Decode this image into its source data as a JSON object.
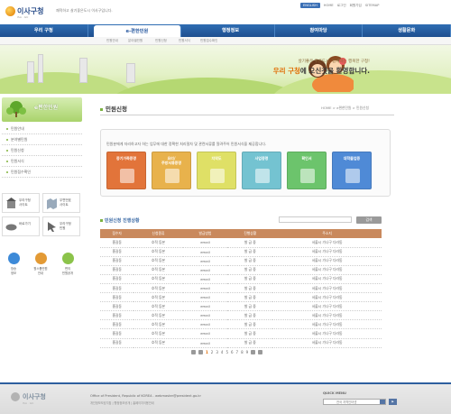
{
  "header": {
    "logo_text": "이사구청",
    "logo_sub": "ISA · GU",
    "slogan": "쾌적하고 살기좋은도시 이사구입니다.",
    "toplinks": [
      "ENGLISH",
      "HOME",
      "로그인",
      "회원가입",
      "SITEMAP"
    ]
  },
  "gnb": {
    "items": [
      "우리 구청",
      "e-편한민원",
      "행정정보",
      "참여마당",
      "생활문화"
    ],
    "active": "e-편한민원"
  },
  "subnav": [
    "민원안내",
    "분야별민원",
    "민원신청",
    "민원서식",
    "민원접수확인"
  ],
  "banner": {
    "line1": "살기좋은 푸른도시, 함께하는 행복한 구청!",
    "line2_a": "우리 구청",
    "line2_b": "에 오신것을 환영합니다."
  },
  "left": {
    "title": "e편한민원",
    "menu": [
      "민원안내",
      "분야별민원",
      "민원신청",
      "민원서식",
      "민원접수확인"
    ],
    "quick": [
      {
        "label": "우리구청\n사이트",
        "icon": "building-icon"
      },
      {
        "label": "우편번호\n사이트",
        "icon": "map-icon"
      },
      {
        "label": "바로가기",
        "icon": "hands-icon"
      },
      {
        "label": "우리구청\n민원",
        "icon": "pointer-icon"
      }
    ],
    "icons": [
      {
        "label": "방송\n정보",
        "color": "#3d8ad8"
      },
      {
        "label": "원스톱민원\n안내",
        "color": "#e39a35"
      },
      {
        "label": "편의\n민원공개",
        "color": "#8bc34a"
      }
    ]
  },
  "content": {
    "title": "민원신청",
    "path": "HOME > e편한민원 > 민원신청",
    "desc": "민원분에게 자리하고자 하는 업무에 대한 정확한 처리절차 및 관련서류를 알려주어 민원서식을 제공합니다.",
    "services": [
      {
        "label": "증기가족증명",
        "color": "#e2743a"
      },
      {
        "label": "요리/\n주방서류증명",
        "color": "#e8b24c"
      },
      {
        "label": "지역도",
        "color": "#dfe066"
      },
      {
        "label": "사업증명",
        "color": "#74c3d1"
      },
      {
        "label": "확인서",
        "color": "#6cc46c"
      },
      {
        "label": "대학졸업증",
        "color": "#4f8ad6"
      }
    ]
  },
  "list": {
    "title": "민원신청 진행상황",
    "search_button": "검색",
    "columns": [
      "접수자",
      "신청종류",
      "발급방법",
      "진행상황",
      "주소지"
    ],
    "rows": [
      [
        "홍길동",
        "호적 등본",
        "email",
        "발 급 중",
        "서울시 가나구 다라동"
      ],
      [
        "홍길동",
        "호적 등본",
        "email",
        "발 급 중",
        "서울시 가나구 다라동"
      ],
      [
        "홍길동",
        "호적 등본",
        "email",
        "발 급 중",
        "서울시 가나구 다라동"
      ],
      [
        "홍길동",
        "호적 등본",
        "email",
        "발 급 중",
        "서울시 가나구 다라동"
      ],
      [
        "홍길동",
        "호적 등본",
        "email",
        "발 급 중",
        "서울시 가나구 다라동"
      ],
      [
        "홍길동",
        "호적 등본",
        "email",
        "발 급 중",
        "서울시 가나구 다라동"
      ],
      [
        "홍길동",
        "호적 등본",
        "email",
        "발 급 중",
        "서울시 가나구 다라동"
      ],
      [
        "홍길동",
        "호적 등본",
        "email",
        "발 급 중",
        "서울시 가나구 다라동"
      ],
      [
        "홍길동",
        "호적 등본",
        "email",
        "발 급 중",
        "서울시 가나구 다라동"
      ],
      [
        "홍길동",
        "호적 등본",
        "email",
        "발 급 중",
        "서울시 가나구 다라동"
      ],
      [
        "홍길동",
        "호적 등본",
        "email",
        "발 급 중",
        "서울시 가나구 다라동"
      ],
      [
        "홍길동",
        "호적 등본",
        "email",
        "발 급 중",
        "서울시 가나구 다라동"
      ]
    ],
    "pages": [
      "1",
      "2",
      "3",
      "4",
      "5",
      "6",
      "7",
      "8",
      "9"
    ],
    "current_page": "1"
  },
  "footer": {
    "logo_text": "이사구청",
    "logo_sub": "ISA · GU",
    "address": "Office of President, Republic of KOREA . webmaster@president.go.kr",
    "links": "개인정보보호지침 | 행정정보공개 | 홈페이지이용안내",
    "quick_menu": "QUICK MENU",
    "quick_select": "전국 지역인터넷"
  },
  "colors": {
    "nav_blue": "#1e4f8f",
    "table_header": "#c9895d",
    "accent_green": "#7cb342"
  }
}
